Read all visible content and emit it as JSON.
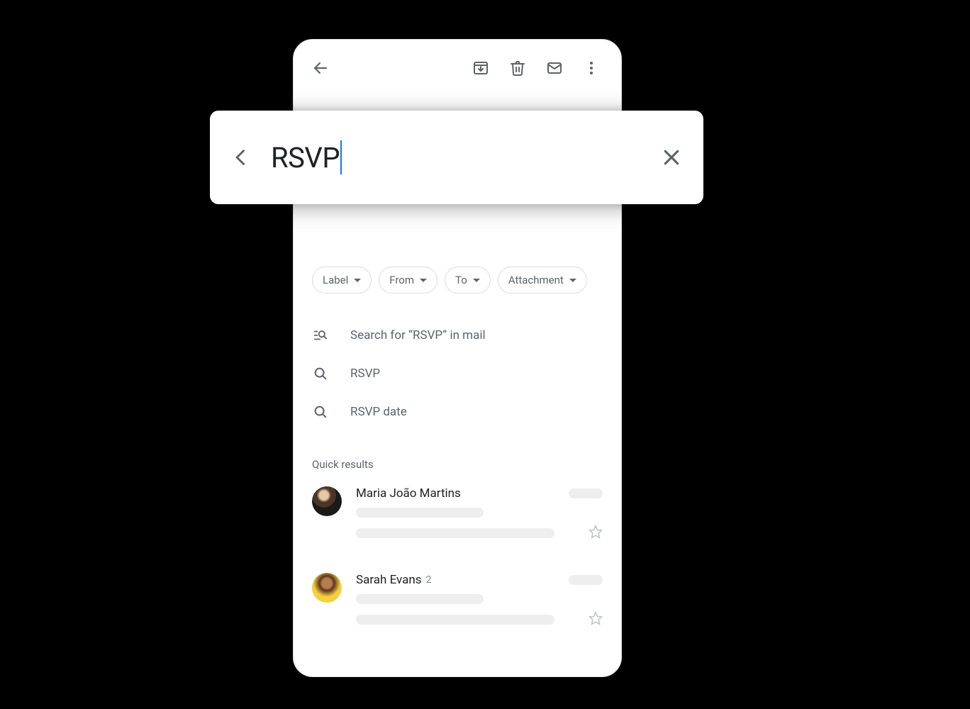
{
  "search": {
    "query": "RSVP"
  },
  "chips": [
    "Label",
    "From",
    "To",
    "Attachment"
  ],
  "suggestions": {
    "searchIn": "Search for “RSVP” in mail",
    "items": [
      "RSVP",
      "RSVP date"
    ]
  },
  "quickResults": {
    "header": "Quick results",
    "items": [
      {
        "name": "Maria João Martins",
        "count": ""
      },
      {
        "name": "Sarah Evans",
        "count": "2"
      }
    ]
  }
}
